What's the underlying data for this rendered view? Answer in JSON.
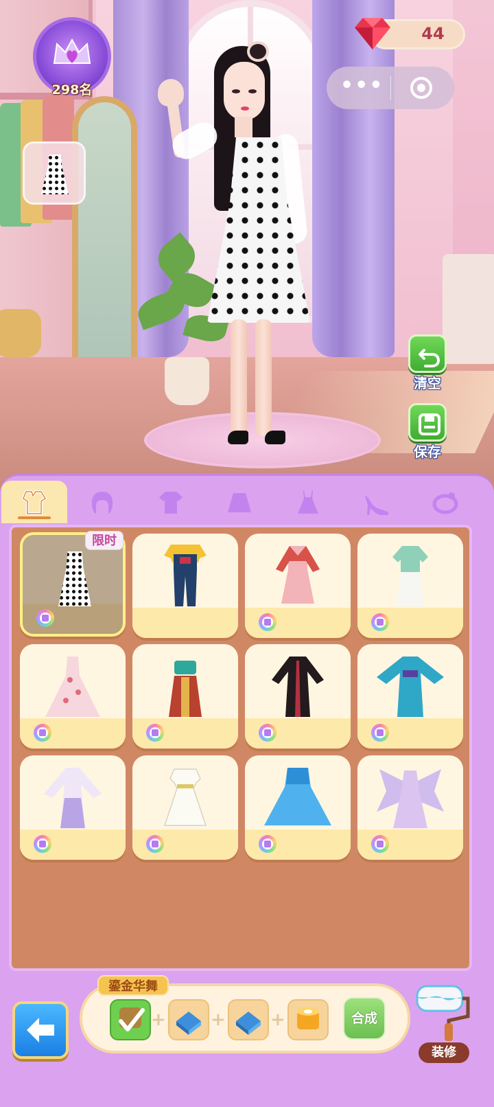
{
  "hud": {
    "rank_text": "298名",
    "gem_count": "44"
  },
  "capsule": {
    "more_icon": "more-dots-icon",
    "close_icon": "target-icon"
  },
  "actions": {
    "clear_label": "清空",
    "save_label": "保存"
  },
  "tabs": [
    {
      "name": "outfit-tab",
      "icon": "outfit-icon",
      "active": true
    },
    {
      "name": "hair-tab",
      "icon": "hair-icon",
      "active": false
    },
    {
      "name": "top-tab",
      "icon": "tshirt-icon",
      "active": false
    },
    {
      "name": "skirt-tab",
      "icon": "skirt-icon",
      "active": false
    },
    {
      "name": "dress-tab",
      "icon": "dress-icon",
      "active": false
    },
    {
      "name": "shoes-tab",
      "icon": "high-heel-icon",
      "active": false
    },
    {
      "name": "accessory-tab",
      "icon": "accessory-icon",
      "active": false
    }
  ],
  "grid": {
    "limited_label": "限时"
  },
  "synthesis": {
    "title": "鎏金华舞",
    "combine_label": "合成"
  },
  "decorate": {
    "label": "装修"
  },
  "colors": {
    "panel": "#dba2ef",
    "grid_bg": "#d08864",
    "accent_green": "#4fbf3a",
    "back_blue": "#1a7fe4"
  }
}
